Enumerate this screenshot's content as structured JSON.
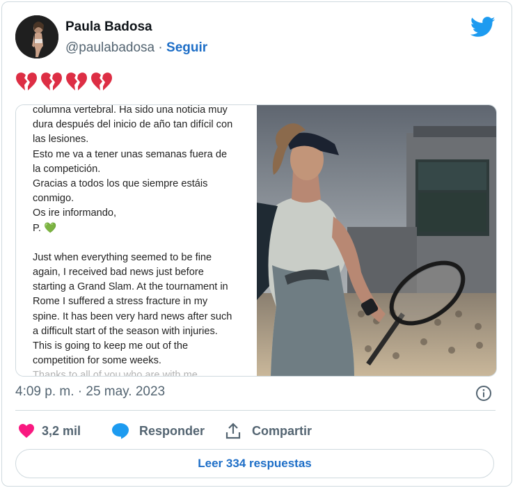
{
  "author": {
    "name": "Paula Badosa",
    "handle": "@paulabadosa",
    "separator": "·",
    "follow_label": "Seguir"
  },
  "icons": {
    "platform": "twitter-bird-icon",
    "tweet_emojis": [
      "broken-heart-icon",
      "broken-heart-icon",
      "broken-heart-icon",
      "broken-heart-icon"
    ],
    "info": "info-circle-icon",
    "like": "heart-icon",
    "reply": "speech-bubble-icon",
    "share": "share-upload-icon"
  },
  "colors": {
    "brand_blue": "#1d9bf0",
    "link_blue": "#1d6ec7",
    "like_pink": "#f91880",
    "broken_heart_red": "#dd2e44",
    "muted_text": "#536471",
    "border": "#cfd9de"
  },
  "media": {
    "text_lines": [
      "columna vertebral. Ha sido una noticia muy",
      "dura después del inicio de año tan difícil con",
      "las lesiones.",
      "Esto me va a tener unas semanas fuera de",
      "la competición.",
      "Gracias a todos los que siempre estáis",
      "conmigo.",
      "Os ire informando,",
      "P.",
      "",
      "Just when everything seemed to be fine",
      "again, I received bad news just before",
      "starting a Grand Slam. At the tournament in",
      "Rome I suffered a stress fracture in my",
      "spine. It has been very hard news after such",
      "a difficult start of the season with injuries.",
      "This is going to keep me out of the",
      "competition for some weeks.",
      "Thanks to all of you who are with me..."
    ],
    "signature_emoji": "💚"
  },
  "tweet": {
    "timestamp": "4:09 p. m. · 25 may. 2023"
  },
  "actions": {
    "likes": "3,2 mil",
    "reply_label": "Responder",
    "share_label": "Compartir",
    "read_replies": "Leer 334 respuestas"
  }
}
